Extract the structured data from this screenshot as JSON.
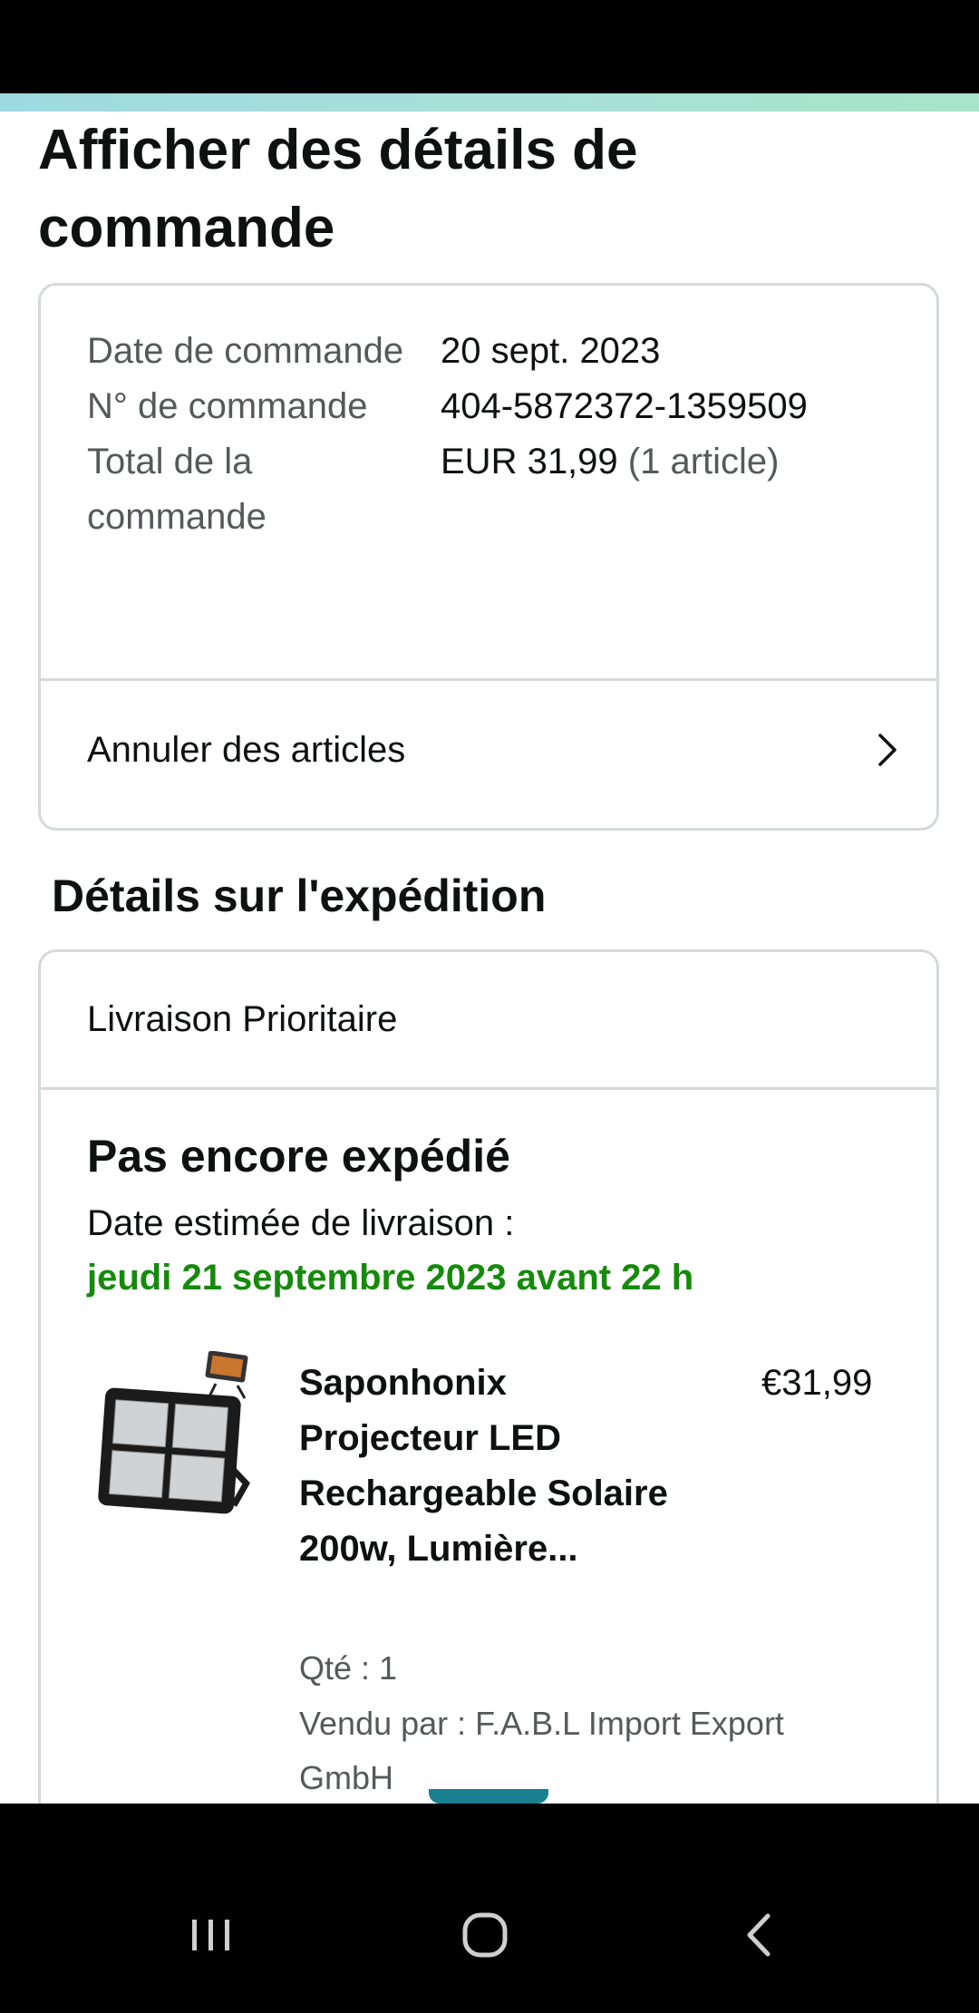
{
  "page": {
    "title": "Afficher des détails de commande"
  },
  "summary": {
    "rows": [
      {
        "label": "Date de commande",
        "value": "20 sept. 2023"
      },
      {
        "label": "N° de commande",
        "value": "404-5872372-1359509"
      },
      {
        "label": "Total de la commande",
        "value": "EUR 31,99",
        "value_extra": "(1 article)"
      }
    ],
    "cancel_label": "Annuler des articles"
  },
  "shipping": {
    "section_title": "Détails sur l'expédition",
    "method": "Livraison Prioritaire",
    "status": "Pas encore expédié",
    "estimate_label": "Date estimée de livraison :",
    "estimate_date": "jeudi 21 septembre 2023 avant 22 h",
    "estimate_color": "#158a0b"
  },
  "product": {
    "title": "Saponhonix Projecteur LED Rechargeable Solaire 200w, Lumière...",
    "price": "€31,99",
    "quantity": "Qté : 1",
    "seller": "Vendu par : F.A.B.L Import Export GmbH"
  },
  "nav": {
    "icons": [
      "recent-apps-icon",
      "home-icon",
      "back-icon"
    ]
  }
}
